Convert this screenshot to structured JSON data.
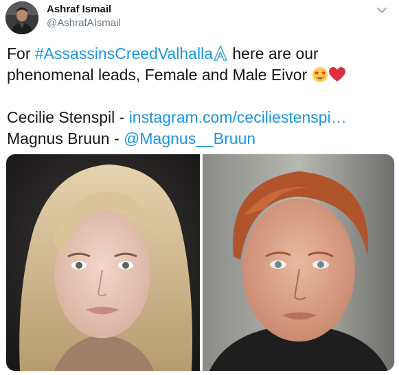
{
  "author": {
    "display_name": "Ashraf Ismail",
    "handle": "@AshrafAIsmail"
  },
  "tweet": {
    "prefix": "For ",
    "hashtag": "#AssassinsCreedValhalla",
    "line1_rest": " here are our",
    "line2": "phenomenal leads, Female and Male Eivor ",
    "credit1_name": "Cecilie Stenspil - ",
    "credit1_link": "instagram.com/ceciliestenspi…",
    "credit2_name": "Magnus Bruun - ",
    "credit2_link": "@Magnus__Bruun"
  },
  "icons": {
    "more": "chevron-down-icon",
    "hashflag": "assassins-creed-hashflag-icon",
    "emoji1": "star-struck-emoji-icon",
    "emoji2": "red-heart-emoji-icon"
  },
  "colors": {
    "link": "#1b95e0",
    "text": "#14171a",
    "secondary": "#657786"
  }
}
